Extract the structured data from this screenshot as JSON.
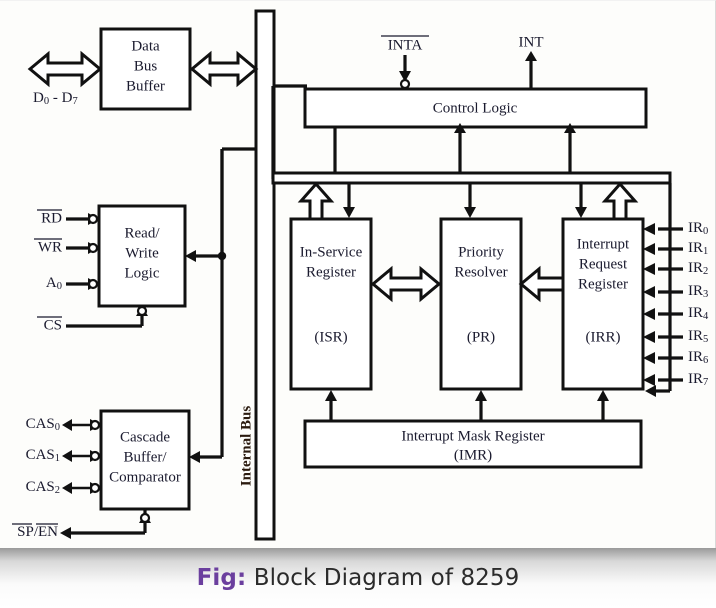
{
  "figure": {
    "caption_prefix": "Fig:",
    "caption_text": " Block Diagram of 8259",
    "accent_color": "#6b3f9e",
    "line_color": "#111111",
    "background_color": "#fdfdfb"
  },
  "blocks": {
    "data_bus_buffer": {
      "line1": "Data",
      "line2": "Bus",
      "line3": "Buffer"
    },
    "read_write_logic": {
      "line1": "Read/",
      "line2": "Write",
      "line3": "Logic"
    },
    "cascade_buffer": {
      "line1": "Cascade",
      "line2": "Buffer/",
      "line3": "Comparator"
    },
    "control_logic": {
      "label": "Control Logic"
    },
    "in_service_register": {
      "line1": "In-Service",
      "line2": "Register",
      "abbrev": "(ISR)"
    },
    "priority_resolver": {
      "line1": "Priority",
      "line2": "Resolver",
      "abbrev": "(PR)"
    },
    "interrupt_request_register": {
      "line1": "Interrupt",
      "line2": "Request",
      "line3": "Register",
      "abbrev": "(IRR)"
    },
    "interrupt_mask_register": {
      "line1": "Interrupt Mask Register",
      "abbrev": "(IMR)"
    },
    "internal_bus": {
      "label": "Internal Bus"
    }
  },
  "signals": {
    "data_bus": {
      "base": "D",
      "sub0": "0",
      "dash": " - ",
      "base2": "D",
      "sub7": "7",
      "full": "D0 - D7"
    },
    "rd": {
      "label": "RD",
      "overbar": true
    },
    "wr": {
      "label": "WR",
      "overbar": true
    },
    "a0": {
      "base": "A",
      "sub": "0",
      "overbar": false
    },
    "cs": {
      "label": "CS",
      "overbar": true
    },
    "sp_en": {
      "part1": "SP",
      "slash": "/",
      "part2": "EN",
      "overbar": true
    },
    "inta": {
      "label": "INTA",
      "overbar": true
    },
    "int": {
      "label": "INT",
      "overbar": false
    },
    "cascade_lines": [
      {
        "base": "CAS",
        "sub": "0"
      },
      {
        "base": "CAS",
        "sub": "1"
      },
      {
        "base": "CAS",
        "sub": "2"
      }
    ],
    "interrupt_requests": [
      {
        "base": "IR",
        "sub": "0"
      },
      {
        "base": "IR",
        "sub": "1"
      },
      {
        "base": "IR",
        "sub": "2"
      },
      {
        "base": "IR",
        "sub": "3"
      },
      {
        "base": "IR",
        "sub": "4"
      },
      {
        "base": "IR",
        "sub": "5"
      },
      {
        "base": "IR",
        "sub": "6"
      },
      {
        "base": "IR",
        "sub": "7"
      }
    ]
  }
}
